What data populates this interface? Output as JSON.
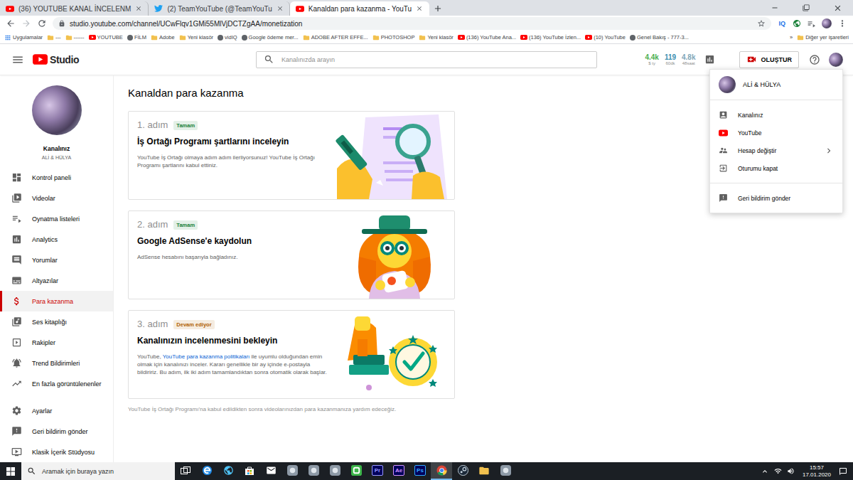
{
  "browser": {
    "tabs": [
      {
        "label": "(36) YOUTUBE KANAL İNCELENM",
        "kind": "youtube",
        "selected": false
      },
      {
        "label": "(2) TeamYouTube (@TeamYouTu",
        "kind": "twitter",
        "selected": false
      },
      {
        "label": "Kanaldan para kazanma - YouTu",
        "kind": "youtube",
        "selected": true
      }
    ],
    "url": "studio.youtube.com/channel/UCwFlqv1GMi55MlVjDCTZgAA/monetization",
    "bookmarked": false,
    "extension_badge": "IQ",
    "bookmarks": [
      {
        "label": "Uygulamalar",
        "kind": "apps"
      },
      {
        "label": "---",
        "kind": "folder"
      },
      {
        "label": "------",
        "kind": "folder"
      },
      {
        "label": "YOUTUBE",
        "kind": "youtube"
      },
      {
        "label": "FİLM",
        "kind": "site"
      },
      {
        "label": "Adobe",
        "kind": "folder"
      },
      {
        "label": "Yeni klasör",
        "kind": "folder"
      },
      {
        "label": "vidIQ",
        "kind": "site"
      },
      {
        "label": "Google ödeme mer...",
        "kind": "site"
      },
      {
        "label": "ADOBE AFTER EFFE...",
        "kind": "folder"
      },
      {
        "label": "PHOTOSHOP",
        "kind": "folder"
      },
      {
        "label": "Yeni klasör",
        "kind": "folder"
      },
      {
        "label": "(136) YouTube Ana...",
        "kind": "youtube"
      },
      {
        "label": "(136) YouTube İzlen...",
        "kind": "youtube"
      },
      {
        "label": "(10) YouTube",
        "kind": "youtube"
      },
      {
        "label": "Genel Bakış - 777-3...",
        "kind": "site"
      }
    ],
    "bookmarks_overflow": "»",
    "other_bookmarks": "Diğer yer işaretleri"
  },
  "studio": {
    "logo": "Studio",
    "search": {
      "placeholder": "Kanalınızda arayın"
    },
    "stats": [
      {
        "value": "4.4k",
        "caption": "$ ty",
        "color": "#4caf50"
      },
      {
        "value": "119",
        "caption": "60dk",
        "color": "#3d8fb0"
      },
      {
        "value": "4.8k",
        "caption": "48saat",
        "color": "#7fa6b8"
      }
    ],
    "create_button": "OLUŞTUR",
    "channel": {
      "label": "Kanalınız",
      "name": "ALİ & HÜLYA"
    },
    "nav": [
      {
        "label": "Kontrol paneli",
        "selected": false
      },
      {
        "label": "Videolar",
        "selected": false
      },
      {
        "label": "Oynatma listeleri",
        "selected": false
      },
      {
        "label": "Analytics",
        "selected": false
      },
      {
        "label": "Yorumlar",
        "selected": false
      },
      {
        "label": "Altyazılar",
        "selected": false
      },
      {
        "label": "Para kazanma",
        "selected": true
      },
      {
        "label": "Ses kitaplığı",
        "selected": false
      },
      {
        "label": "Rakipler",
        "selected": false
      },
      {
        "label": "Trend Bildirimleri",
        "selected": false
      },
      {
        "label": "En fazla görüntülenenler",
        "selected": false
      }
    ],
    "footer_nav": [
      {
        "label": "Ayarlar",
        "selected": false
      },
      {
        "label": "Geri bildirim gönder",
        "selected": false
      },
      {
        "label": "Klasik İçerik Stüdyosu",
        "selected": false
      }
    ],
    "page": {
      "title": "Kanaldan para kazanma",
      "steps": [
        {
          "step": "1. adım",
          "badge": {
            "label": "Tamam",
            "color": "#188038"
          },
          "title": "İş Ortağı Programı şartlarını inceleyin",
          "description": [
            {
              "text": "YouTube İş Ortağı olmaya adım adım ilerliyorsunuz! YouTube İş Ortağı Programı şartlarını kabul ettiniz.",
              "link": false
            }
          ]
        },
        {
          "step": "2. adım",
          "badge": {
            "label": "Tamam",
            "color": "#188038"
          },
          "title": "Google AdSense'e kaydolun",
          "description": [
            {
              "text": "AdSense hesabını başarıyla bağladınız.",
              "link": false
            }
          ]
        },
        {
          "step": "3. adım",
          "badge": {
            "label": "Devam ediyor",
            "color": "#b06000"
          },
          "title": "Kanalınızın incelenmesini bekleyin",
          "description": [
            {
              "text": "YouTube, ",
              "link": false
            },
            {
              "text": "YouTube para kazanma politikaları",
              "link": true
            },
            {
              "text": " ile uyumlu olduğundan emin olmak için kanalınızı inceler. Kararı genellikle bir ay içinde e-postayla bildiririz. Bu adım, ilk iki adım tamamlandıktan sonra otomatik olarak başlar.",
              "link": false
            }
          ]
        }
      ],
      "note": "YouTube İş Ortağı Programı'na kabul edildikten sonra videolarınızdan para kazanmanıza yardım edeceğiz."
    },
    "account_menu": {
      "name": "ALİ & HÜLYA",
      "items": [
        {
          "label": "Kanalınız",
          "submenu": false
        },
        {
          "label": "YouTube",
          "submenu": false
        },
        {
          "label": "Hesap değiştir",
          "submenu": true
        },
        {
          "label": "Oturumu kapat",
          "submenu": false
        }
      ],
      "footer_items": [
        {
          "label": "Geri bildirim gönder",
          "submenu": false
        }
      ]
    }
  },
  "taskbar": {
    "search_placeholder": "Aramak için buraya yazın",
    "apps": [
      {
        "kind": "taskview",
        "active": false
      },
      {
        "kind": "edge",
        "active": false
      },
      {
        "kind": "media",
        "active": false
      },
      {
        "kind": "store",
        "active": false
      },
      {
        "kind": "mail",
        "active": false
      },
      {
        "kind": "app",
        "active": false
      },
      {
        "kind": "app",
        "active": false
      },
      {
        "kind": "app",
        "active": false
      },
      {
        "kind": "camtasia",
        "active": false
      },
      {
        "kind": "adobe",
        "label": "Pr",
        "color": "#9999ff",
        "active": false
      },
      {
        "kind": "adobe",
        "label": "Ae",
        "color": "#d291ff",
        "active": false
      },
      {
        "kind": "adobe",
        "label": "Ps",
        "color": "#31a8ff",
        "active": false
      },
      {
        "kind": "chrome",
        "active": true
      },
      {
        "kind": "steam",
        "active": false
      },
      {
        "kind": "explorer",
        "active": false
      },
      {
        "kind": "app",
        "active": false
      }
    ],
    "time": "15:57",
    "date": "17.01.2020"
  }
}
